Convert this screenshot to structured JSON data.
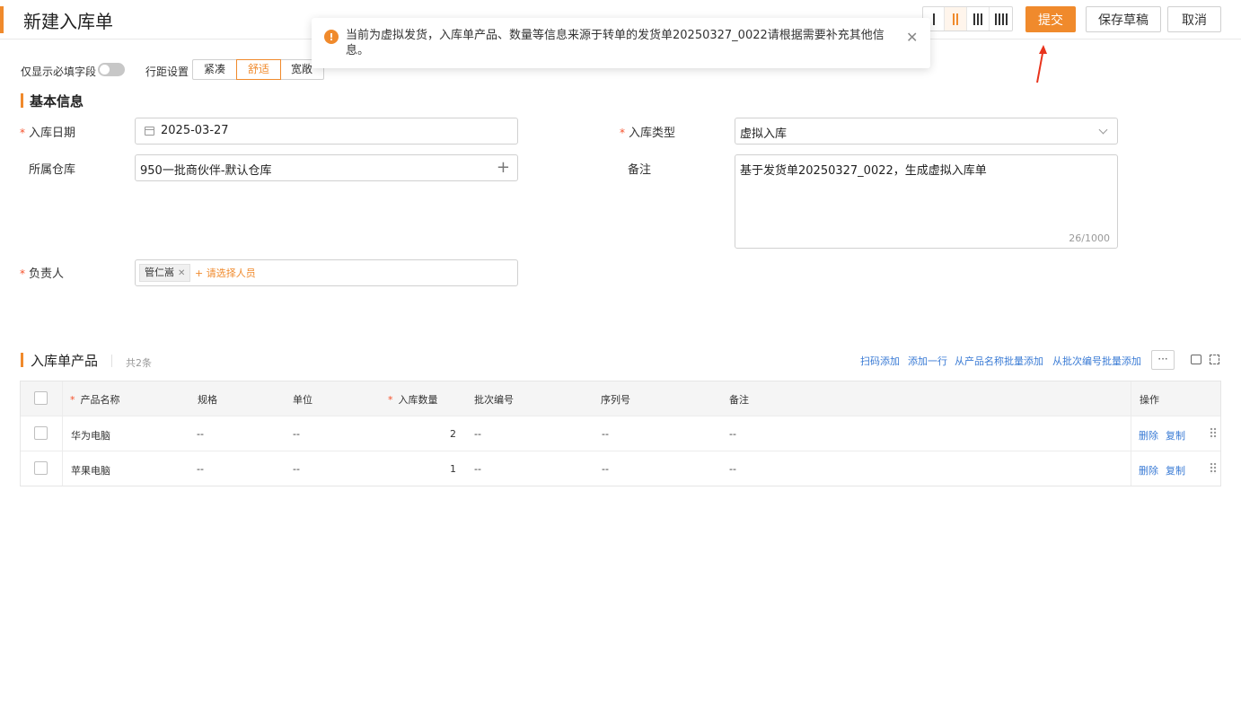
{
  "header": {
    "title": "新建入库单",
    "column_options": [
      "I",
      "II",
      "III",
      "IIII"
    ],
    "active_column": "II",
    "submit_label": "提交",
    "draft_label": "保存草稿",
    "cancel_label": "取消",
    "accent_color": "#f08a2c"
  },
  "notice": {
    "icon": "warning-icon",
    "message": "当前为虚拟发货，入库单产品、数量等信息来源于转单的发货单20250327_0022请根据需要补充其他信息。",
    "close_icon": "close-icon"
  },
  "toolbar": {
    "required_only_label": "仅显示必填字段",
    "required_only_on": false,
    "row_spacing_label": "行距设置",
    "density_options": [
      "紧凑",
      "舒适",
      "宽敞"
    ],
    "density_selected": "舒适"
  },
  "basic_info": {
    "section_title": "基本信息",
    "date_label": "入库日期",
    "date_value": "2025-03-27",
    "type_label": "入库类型",
    "type_value": "虚拟入库",
    "warehouse_label": "所属仓库",
    "warehouse_value": "950一批商伙伴-默认仓库",
    "remark_label": "备注",
    "remark_value": "基于发货单20250327_0022，生成虚拟入库单",
    "remark_counter": "26/1000",
    "owner_label": "负责人",
    "owner_tag": "管仁嵩",
    "owner_add": "+ 请选择人员"
  },
  "products": {
    "section_title": "入库单产品",
    "count_text": "共2条",
    "actions": [
      "扫码添加",
      "添加一行",
      "从产品名称批量添加",
      "从批次编号批量添加"
    ],
    "more_label": "···",
    "columns": [
      "产品名称",
      "规格",
      "单位",
      "入库数量",
      "批次编号",
      "序列号",
      "备注",
      "操作"
    ],
    "rows": [
      {
        "name": "华为电脑",
        "spec": "--",
        "unit": "--",
        "qty": "2",
        "batch": "--",
        "serial": "--",
        "remark": "--",
        "delete": "删除",
        "copy": "复制"
      },
      {
        "name": "苹果电脑",
        "spec": "--",
        "unit": "--",
        "qty": "1",
        "batch": "--",
        "serial": "--",
        "remark": "--",
        "delete": "删除",
        "copy": "复制"
      }
    ]
  }
}
